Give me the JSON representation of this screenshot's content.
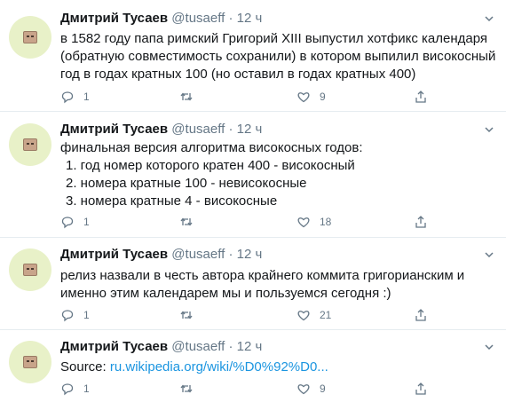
{
  "tweets": [
    {
      "name": "Дмитрий Тусаев",
      "handle": "@tusaeff",
      "dot": "·",
      "time": "12 ч",
      "lines": [
        "в 1582 году папа римский Григорий XIII выпустил хотфикс календаря",
        "(обратную совместимость сохранили) в котором выпилил високосный",
        "год в годах кратных 100 (но оставил в годах кратных 400)"
      ],
      "reply_count": "1",
      "retweet_count": "",
      "like_count": "9"
    },
    {
      "name": "Дмитрий Тусаев",
      "handle": "@tusaeff",
      "dot": "·",
      "time": "12 ч",
      "lines": [
        "финальная версия алгоритма високосных годов:",
        "1. год номер которого кратен 400 - високосный",
        "2. номера кратные 100 - невисокосные",
        "3. номера кратные 4 - високосные"
      ],
      "reply_count": "1",
      "retweet_count": "",
      "like_count": "18"
    },
    {
      "name": "Дмитрий Тусаев",
      "handle": "@tusaeff",
      "dot": "·",
      "time": "12 ч",
      "lines": [
        "релиз назвали в честь автора крайнего коммита григорианским и",
        "именно этим календарем мы и пользуемся сегодня :)"
      ],
      "reply_count": "1",
      "retweet_count": "",
      "like_count": "21"
    },
    {
      "name": "Дмитрий Тусаев",
      "handle": "@tusaeff",
      "dot": "·",
      "time": "12 ч",
      "source_label": "Source: ",
      "source_link": "ru.wikipedia.org/wiki/%D0%92%D0...",
      "reply_count": "1",
      "retweet_count": "",
      "like_count": "9"
    }
  ]
}
